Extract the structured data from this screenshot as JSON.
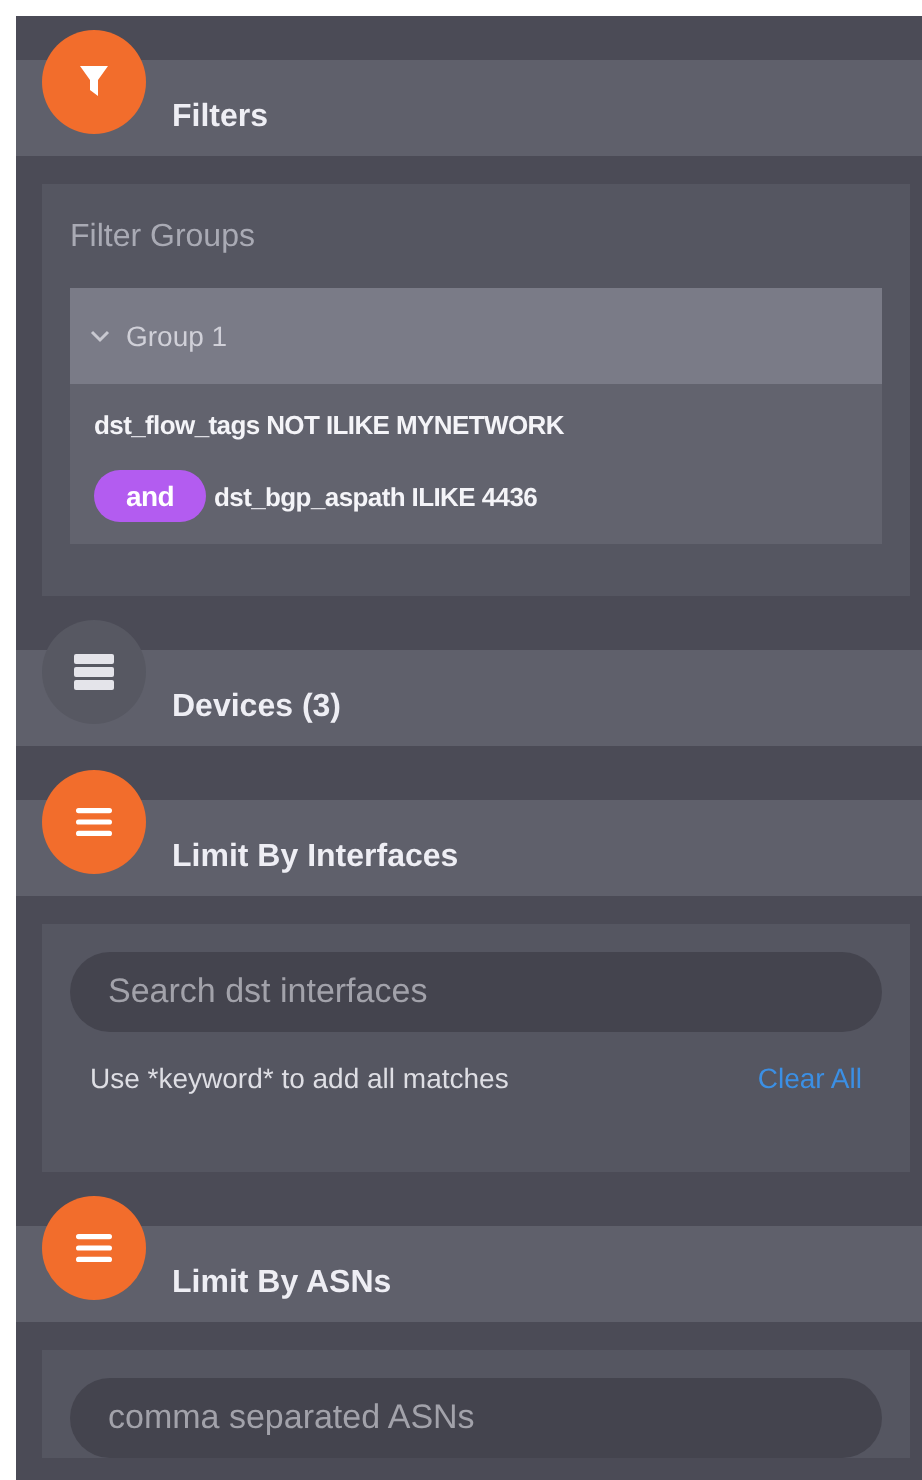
{
  "sections": [
    {
      "kind": "filters",
      "title": "Filters",
      "expanded": true,
      "subtitle": "Filter Groups",
      "groups": [
        {
          "title": "Group 1",
          "expanded": true,
          "rules": [
            {
              "text": "dst_flow_tags NOT ILIKE MYNETWORK"
            },
            {
              "connector": "and",
              "text": "dst_bgp_aspath ILIKE 4436"
            }
          ]
        }
      ]
    },
    {
      "kind": "plain",
      "title": "Devices (3)",
      "expanded": false
    },
    {
      "kind": "search",
      "title": "Limit By Interfaces",
      "expanded": true,
      "placeholder": "Search dst interfaces",
      "hint": "Use *keyword* to add all matches",
      "action": "Clear All"
    },
    {
      "kind": "search",
      "title": "Limit By ASNs",
      "expanded": true,
      "placeholder": "comma separated ASNs"
    }
  ]
}
